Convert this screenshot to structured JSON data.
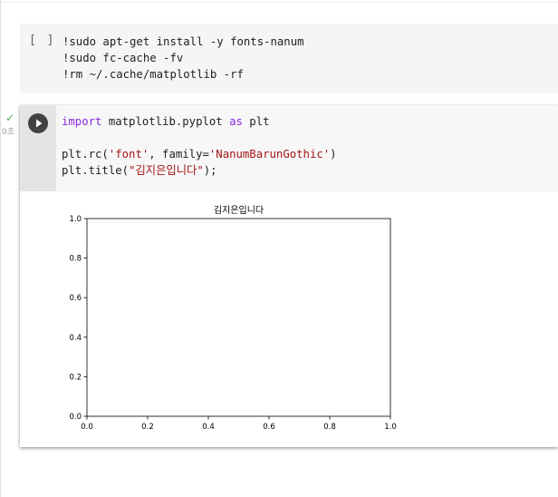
{
  "cell1": {
    "bracket": "[ ]",
    "lines": [
      "!sudo apt-get install -y fonts-nanum",
      "!sudo fc-cache -fv",
      "!rm ~/.cache/matplotlib -rf"
    ]
  },
  "cell2": {
    "status_icon": "check-icon",
    "status_time": "0초",
    "run_icon": "play-icon",
    "code": {
      "line1_kw": "import",
      "line1_mid": " matplotlib.pyplot ",
      "line1_as": "as",
      "line1_end": " plt",
      "line3_pre": "plt.rc(",
      "line3_str1": "'font'",
      "line3_mid": ", family=",
      "line3_str2": "'NanumBarunGothic'",
      "line3_end": ")",
      "line4_pre": "plt.title(",
      "line4_str": "\"김지은입니다\"",
      "line4_end": ");"
    }
  },
  "colors": {
    "keyword": "#8a2be2",
    "string": "#a31515",
    "run_button": "#424242",
    "status_ok": "#4caf50"
  },
  "chart_data": {
    "type": "line",
    "title": "김지은입니다",
    "xlabel": "",
    "ylabel": "",
    "series": [],
    "xlim": [
      0.0,
      1.0
    ],
    "ylim": [
      0.0,
      1.0
    ],
    "xticks": [
      "0.0",
      "0.2",
      "0.4",
      "0.6",
      "0.8",
      "1.0"
    ],
    "yticks": [
      "0.0",
      "0.2",
      "0.4",
      "0.6",
      "0.8",
      "1.0"
    ],
    "grid": false,
    "legend": "none"
  }
}
